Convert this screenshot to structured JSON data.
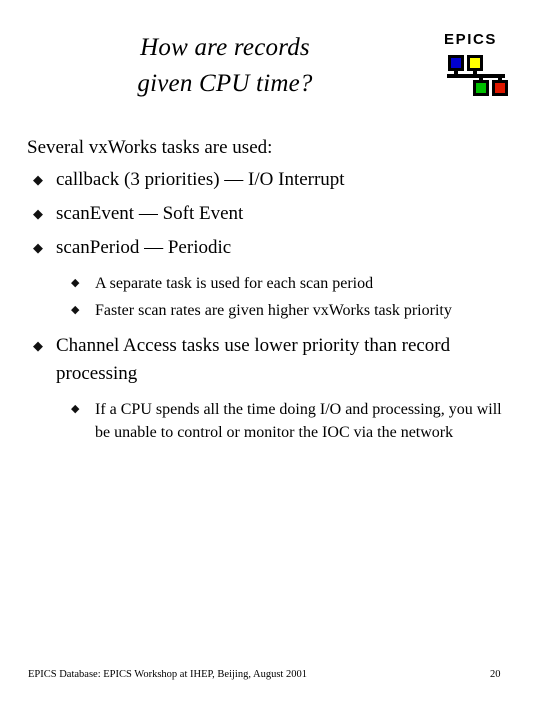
{
  "slide": {
    "title_lines": [
      "How are records",
      "given CPU time?"
    ],
    "lead": "Several vxWorks tasks are used:",
    "bullet_glyph": "◆",
    "bullets": [
      {
        "level": 1,
        "text": "callback (3 priorities) — I/O Interrupt"
      },
      {
        "level": 1,
        "text": "scanEvent — Soft Event"
      },
      {
        "level": 1,
        "text": "scanPeriod — Periodic"
      },
      {
        "level": 2,
        "text": "A separate task is used for each scan period"
      },
      {
        "level": 2,
        "text": "Faster scan rates are given higher vxWorks task priority"
      },
      {
        "level": 1,
        "text": "Channel Access tasks use lower priority than record processing"
      },
      {
        "level": 2,
        "text": "If a CPU spends all the time doing I/O and processing, you will be unable to control or monitor the IOC via the network"
      }
    ]
  },
  "logo": {
    "wordmark": "EPICS",
    "colors": {
      "blue": "#0000d0",
      "yellow": "#ffff00",
      "green": "#00c000",
      "red": "#e01800",
      "outline": "#000000"
    }
  },
  "footer": {
    "text": "EPICS Database: EPICS Workshop at IHEP, Beijing, August 2001",
    "page_number": "20"
  }
}
